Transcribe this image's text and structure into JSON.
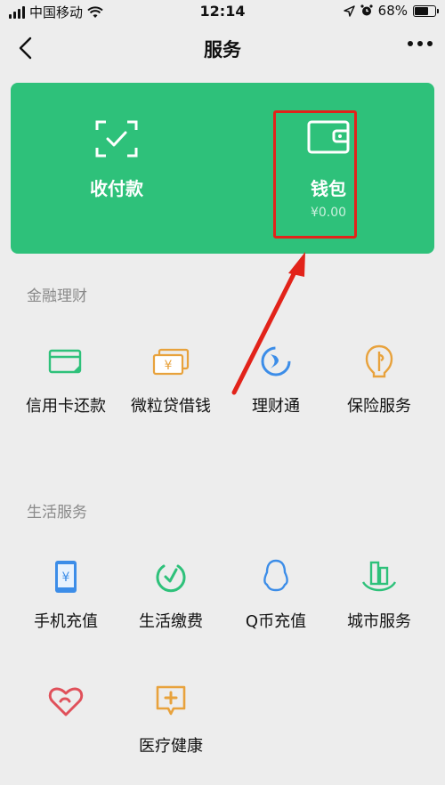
{
  "status_bar": {
    "carrier": "中国移动",
    "time": "12:14",
    "battery": "68%"
  },
  "nav": {
    "title": "服务"
  },
  "card": {
    "items": [
      {
        "label": "收付款",
        "icon": "scan-pay-icon"
      },
      {
        "label": "钱包",
        "sub": "¥0.00",
        "icon": "wallet-icon"
      }
    ]
  },
  "sections": [
    {
      "title": "金融理财",
      "items": [
        {
          "label": "信用卡还款",
          "icon": "credit-card-icon",
          "color": "#2ec17a"
        },
        {
          "label": "微粒贷借钱",
          "icon": "loan-icon",
          "color": "#e8a23c"
        },
        {
          "label": "理财通",
          "icon": "licaitong-icon",
          "color": "#3c8de8"
        },
        {
          "label": "保险服务",
          "icon": "insurance-icon",
          "color": "#e8a23c"
        }
      ]
    },
    {
      "title": "生活服务",
      "items": [
        {
          "label": "手机充值",
          "icon": "phone-recharge-icon",
          "color": "#3c8de8"
        },
        {
          "label": "生活缴费",
          "icon": "utility-bill-icon",
          "color": "#2ec17a"
        },
        {
          "label": "Q币充值",
          "icon": "qq-coin-icon",
          "color": "#3c8de8"
        },
        {
          "label": "城市服务",
          "icon": "city-service-icon",
          "color": "#2ec17a"
        },
        {
          "label": "",
          "icon": "charity-icon",
          "color": "#e0505a"
        },
        {
          "label": "医疗健康",
          "icon": "medical-health-icon",
          "color": "#e8a23c"
        }
      ]
    }
  ]
}
